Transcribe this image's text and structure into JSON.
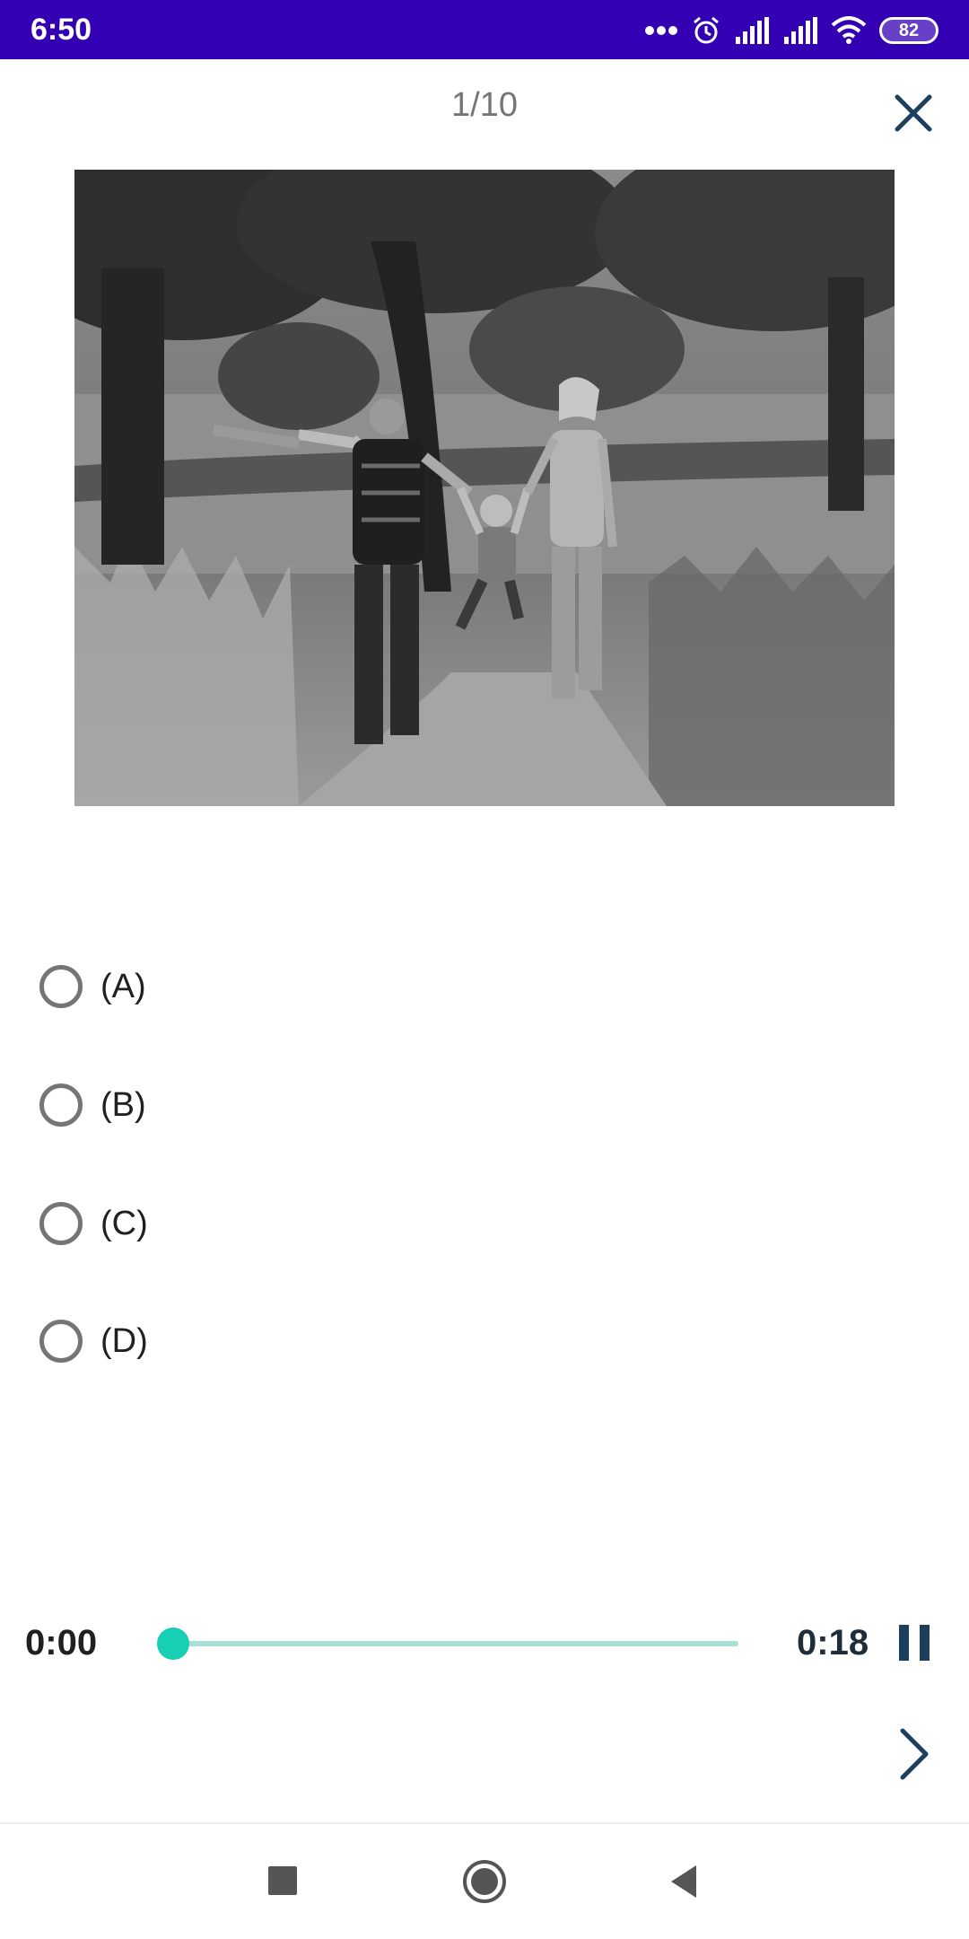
{
  "status_bar": {
    "time": "6:50",
    "battery": "82",
    "icons": [
      "more-dots-icon",
      "alarm-icon",
      "signal-icon",
      "signal-icon",
      "wifi-icon",
      "battery-icon"
    ],
    "background_color": "#3300b3"
  },
  "header": {
    "progress": "1/10",
    "close_icon": "close-icon"
  },
  "question": {
    "image_description_icon": "photo",
    "options": [
      {
        "label": "(A)",
        "selected": false
      },
      {
        "label": "(B)",
        "selected": false
      },
      {
        "label": "(C)",
        "selected": false
      },
      {
        "label": "(D)",
        "selected": false
      }
    ]
  },
  "player": {
    "current_time": "0:00",
    "total_time": "0:18",
    "progress_fraction": 0.0,
    "accent_color": "#17cfb5",
    "pause_icon": "pause-icon",
    "next_icon": "chevron-right-icon"
  },
  "navigation_bar": {
    "icons": [
      "recents-square-icon",
      "home-circle-icon",
      "back-triangle-icon"
    ]
  }
}
